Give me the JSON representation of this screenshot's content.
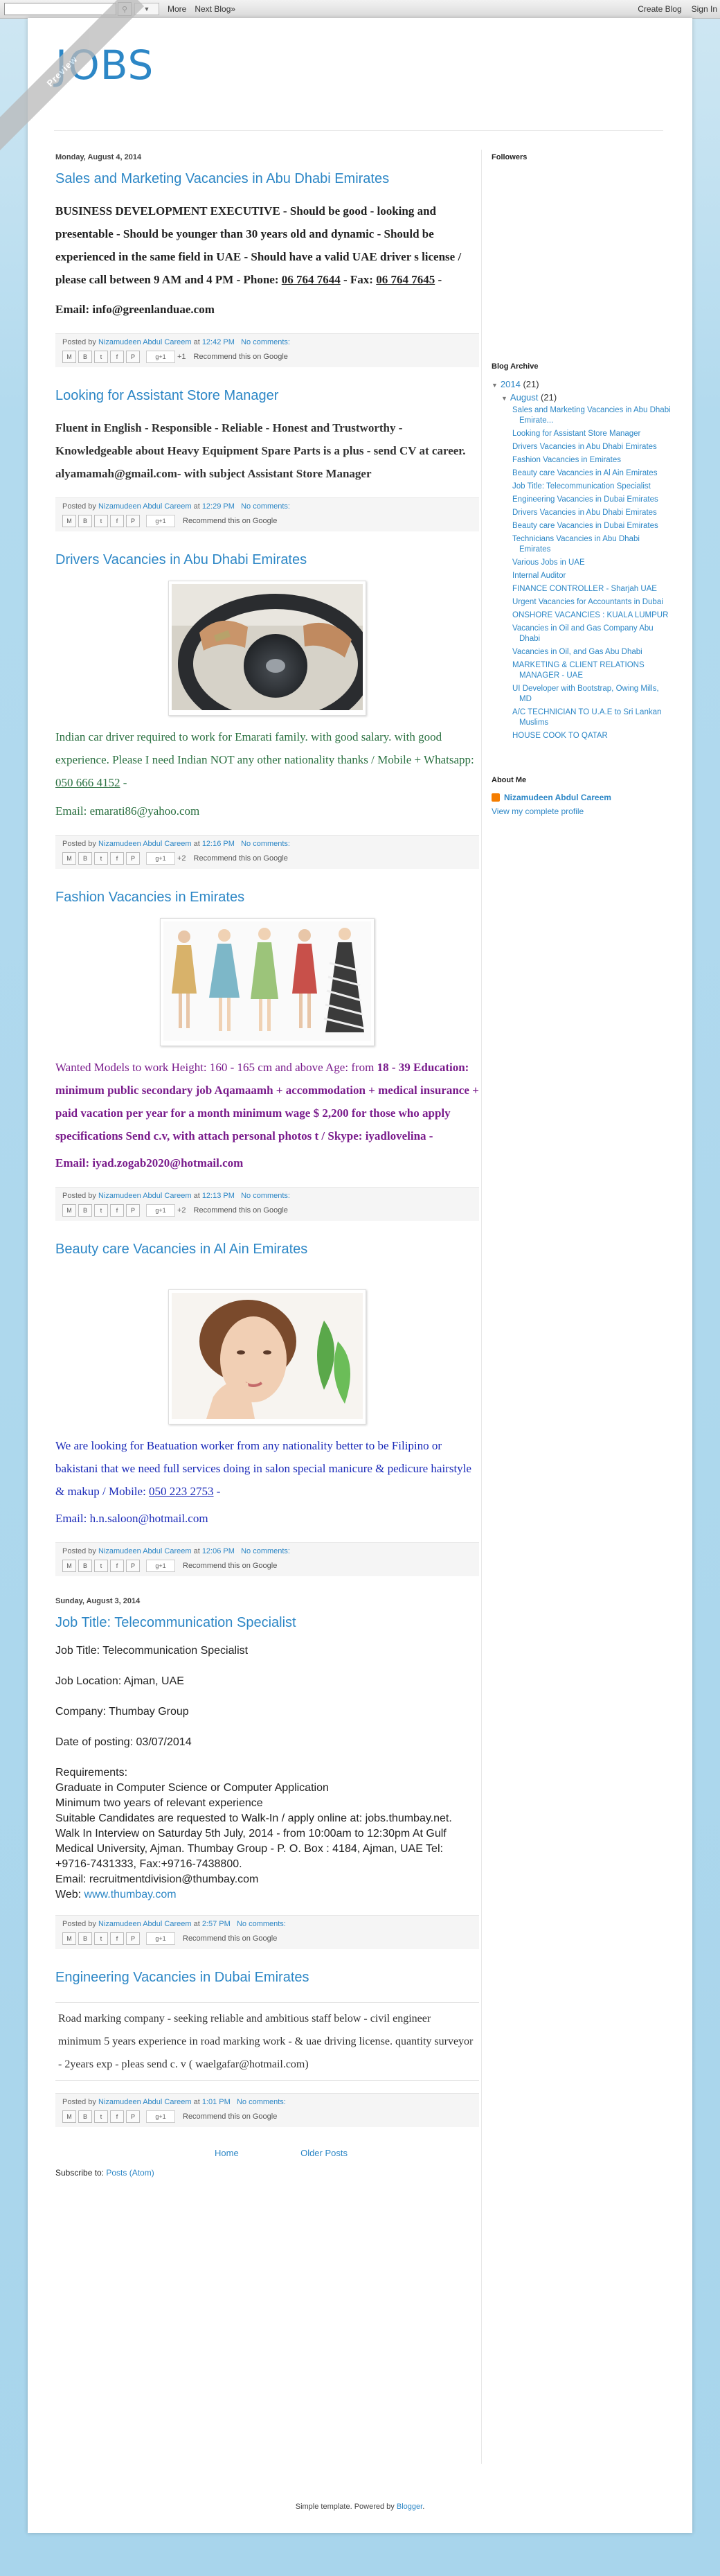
{
  "navbar": {
    "more_label": "More",
    "next_blog_label": "Next Blog»",
    "create_blog_label": "Create Blog",
    "sign_in_label": "Sign In"
  },
  "ribbon": {
    "label": "Preview"
  },
  "header": {
    "title": "JOBS"
  },
  "dates": {
    "d1": "Monday, August 4, 2014",
    "d2": "Sunday, August 3, 2014"
  },
  "posts": {
    "p1": {
      "title": "Sales and Marketing Vacancies in Abu Dhabi Emirates",
      "body1": "BUSINESS DEVELOPMENT EXECUTIVE - Should be good - looking and presentable - Should be younger than 30 years old and dynamic - Should be experienced in the same field in UAE - Should have a valid UAE driver s license / please call between 9 AM and 4 PM - Phone: ",
      "phone": "06 764 7644",
      "fax_label": " - Fax: ",
      "fax": "06 764 7645",
      "after_fax": " -",
      "email_line": "Email: info@greenlanduae.com",
      "posted_by": "Posted by ",
      "author": "Nizamudeen Abdul Careem",
      "at": " at ",
      "time": "12:42 PM",
      "comments": "No comments:",
      "plusone": "+1",
      "recommend": "Recommend this on Google"
    },
    "p2": {
      "title": "Looking for Assistant Store Manager",
      "body": "Fluent in English - Responsible - Reliable - Honest and Trustworthy - Knowledgeable about Heavy Equipment Spare Parts is a plus - send CV at career. alyamamah@gmail.com- with subject Assistant Store Manager",
      "posted_by": "Posted by ",
      "author": "Nizamudeen Abdul Careem",
      "at": " at ",
      "time": "12:29 PM",
      "comments": "No comments:",
      "recommend": "Recommend this on Google"
    },
    "p3": {
      "title": "Drivers Vacancies in Abu Dhabi Emirates",
      "body": "Indian car driver required to work for Emarati family. with good salary. with good experience. Please I need Indian NOT any other nationality thanks / Mobile + Whatsapp: ",
      "mobile": "050 666 4152",
      "after_mobile": " -",
      "email_line": "Email: emarati86@yahoo.com",
      "posted_by": "Posted by ",
      "author": "Nizamudeen Abdul Careem",
      "at": " at ",
      "time": "12:16 PM",
      "comments": "No comments:",
      "plusone": "+2",
      "recommend": "Recommend this on Google"
    },
    "p4": {
      "title": "Fashion Vacancies in Emirates",
      "body_plain": "Wanted Models to work Height: 160 - 165 cm and above Age: from ",
      "body_bold": "18 - 39 Education: minimum public secondary job Aqamaamh + accommodation + medical insurance + paid vacation per year for a month minimum wage $ 2,200 for those who apply specifications Send c.v, with attach personal photos t / Skype: iyadlovelina  -",
      "email_line": "Email:  iyad.zogab2020@hotmail.com",
      "posted_by": "Posted by ",
      "author": "Nizamudeen Abdul Careem",
      "at": " at ",
      "time": "12:13 PM",
      "comments": "No comments:",
      "plusone": "+2",
      "recommend": "Recommend this on Google"
    },
    "p5": {
      "title": "Beauty care Vacancies in Al Ain Emirates",
      "body": "We are looking for Beatuation worker from any nationality better to be Filipino or bakistani that we need full services doing in salon special manicure & pedicure hairstyle & makup / Mobile: ",
      "mobile": "050 223 2753",
      "after_mobile": " -",
      "email_line": "Email:  h.n.saloon@hotmail.com",
      "posted_by": "Posted by ",
      "author": "Nizamudeen Abdul Careem",
      "at": " at ",
      "time": "12:06 PM",
      "comments": "No comments:",
      "recommend": "Recommend this on Google"
    },
    "p6": {
      "title": "Job Title: Telecommunication Specialist",
      "l1": "Job Title: Telecommunication Specialist",
      "l2": "Job Location: Ajman, UAE",
      "l3": "Company: Thumbay Group",
      "l4": "Date of posting: 03/07/2014",
      "req": "Requirements:",
      "r1": "Graduate in Computer Science or Computer Application",
      "r2": "Minimum two years of relevant experience",
      "r3": "Suitable Candidates are requested to Walk-In / apply online at: jobs.thumbay.net.",
      "r4": "Walk In Interview on Saturday 5th July, 2014 - from 10:00am to 12:30pm At Gulf Medical University, Ajman. Thumbay Group - P. O. Box : 4184, Ajman, UAE Tel: +9716-7431333, Fax:+9716-7438800.",
      "r5": "Email: recruitmentdivision@thumbay.com",
      "web_label": "Web: ",
      "web": "www.thumbay.com",
      "posted_by": "Posted by ",
      "author": "Nizamudeen Abdul Careem",
      "at": " at ",
      "time": "2:57 PM",
      "comments": "No comments:",
      "recommend": "Recommend this on Google"
    },
    "p7": {
      "title": "Engineering Vacancies in Dubai Emirates",
      "body": "Road marking company - seeking reliable and ambitious staff below - civil engineer minimum 5 years experience in road marking work - & uae driving license. quantity surveyor - 2years exp - pleas send c. v ( waelgafar@hotmail.com)",
      "posted_by": "Posted by ",
      "author": "Nizamudeen Abdul Careem",
      "at": " at ",
      "time": "1:01 PM",
      "comments": "No comments:",
      "recommend": "Recommend this on Google"
    }
  },
  "pager": {
    "home": "Home",
    "older": "Older Posts"
  },
  "subscribe": {
    "label": "Subscribe to: ",
    "link": "Posts (Atom)"
  },
  "sidebar": {
    "followers_title": "Followers",
    "archive_title": "Blog Archive",
    "year": "2014",
    "year_count": "(21)",
    "month": "August",
    "month_count": "(21)",
    "archive_posts": [
      "Sales and Marketing Vacancies in Abu Dhabi Emirate...",
      "Looking for Assistant Store Manager",
      "Drivers Vacancies in Abu Dhabi Emirates",
      "Fashion Vacancies in Emirates",
      "Beauty care Vacancies in Al Ain Emirates",
      "Job Title: Telecommunication Specialist",
      "Engineering Vacancies in Dubai Emirates",
      "Drivers Vacancies in Abu Dhabi Emirates",
      "Beauty care Vacancies in Dubai Emirates",
      "Technicians Vacancies in Abu Dhabi Emirates",
      "Various Jobs in UAE",
      "Internal Auditor",
      "FINANCE CONTROLLER - Sharjah UAE",
      "Urgent Vacancies for Accountants in Dubai",
      "ONSHORE VACANCIES : KUALA LUMPUR",
      "Vacancies in Oil and Gas Company Abu Dhabi",
      "Vacancies in Oil, and Gas Abu Dhabi",
      "MARKETING & CLIENT RELATIONS MANAGER - UAE",
      "UI Developer with Bootstrap, Owing Mills, MD",
      "A/C TECHNICIAN TO U.A.E to Sri Lankan Muslims",
      "HOUSE COOK TO QATAR"
    ],
    "about_title": "About Me",
    "about_name": "Nizamudeen Abdul Careem",
    "view_profile": "View my complete profile"
  },
  "attribution": {
    "text": "Simple template. Powered by ",
    "link": "Blogger",
    "end": "."
  }
}
